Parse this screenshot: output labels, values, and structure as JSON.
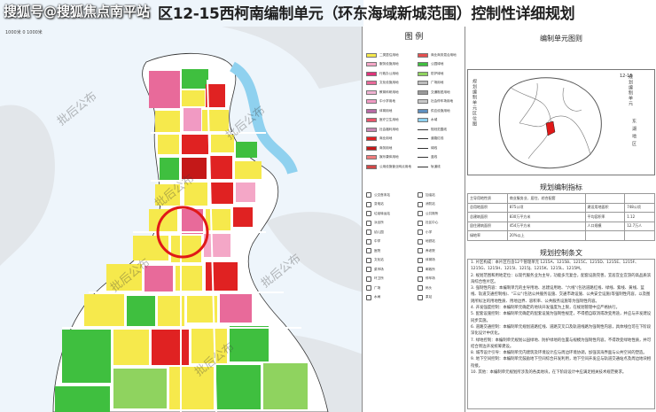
{
  "header": {
    "source_banner": "搜狐号@搜狐焦点南平站",
    "plan_title": "区12-15西柯南编制单元（环东海域新城范围）控制性详细规划"
  },
  "map": {
    "scale_note": "1000米  0  1000米",
    "watermark": "批后公布"
  },
  "legend": {
    "title": "图  例",
    "items": [
      {
        "label": "二类居住用地",
        "color": "#f6e94c"
      },
      {
        "label": "服务设施用地",
        "color": "#f4a7c7"
      },
      {
        "label": "行政办公用地",
        "color": "#e0337a"
      },
      {
        "label": "文化设施用地",
        "color": "#e86a9a"
      },
      {
        "label": "教育科研用地",
        "color": "#f0b2d2"
      },
      {
        "label": "中小学用地",
        "color": "#f19ac3"
      },
      {
        "label": "体育用地",
        "color": "#b86ba6"
      },
      {
        "label": "医疗卫生用地",
        "color": "#e9556d"
      },
      {
        "label": "社会福利用地",
        "color": "#c78ab4"
      },
      {
        "label": "商业用地",
        "color": "#e02222"
      },
      {
        "label": "商务用地",
        "color": "#c41818"
      },
      {
        "label": "娱乐康体用地",
        "color": "#f07d7d"
      },
      {
        "label": "公用设施营业网点用地",
        "color": "#d04848"
      },
      {
        "label": "商业商务混合用地",
        "color": "#e55050"
      },
      {
        "label": "公园绿地",
        "color": "#3fbf3f"
      },
      {
        "label": "防护绿地",
        "color": "#8fd35f"
      },
      {
        "label": "广场用地",
        "color": "#bcbcbc"
      },
      {
        "label": "交通枢纽用地",
        "color": "#9a9a9a"
      },
      {
        "label": "社会停车场用地",
        "color": "#c8c8c8"
      },
      {
        "label": "供应设施用地",
        "color": "#5f8fbf"
      },
      {
        "label": "水域",
        "color": "#8fd1ef"
      },
      {
        "label": "规划范围线",
        "line": true
      },
      {
        "label": "道路红线",
        "line": true
      },
      {
        "label": "绿线",
        "line": true
      },
      {
        "label": "蓝线",
        "line": true
      },
      {
        "label": "轨道线",
        "line": true
      }
    ],
    "symbols": [
      "公交首末站",
      "加油站",
      "变电站",
      "消防站",
      "垃圾转运站",
      "公共厕所",
      "派出所",
      "社区中心",
      "幼儿园",
      "小学",
      "中学",
      "地铁站",
      "医院",
      "养老院",
      "文化站",
      "体育场",
      "菜市场",
      "邮政所",
      "环卫所",
      "停车场",
      "广场",
      "码头",
      "水闸",
      "泵站"
    ]
  },
  "panel": {
    "unit_title": "编制单元图则",
    "locator_vertical_left": "规划编制单元区位图",
    "locator_vertical_right": "东 湖 地 区",
    "locator_right_top": "规划编制单元",
    "locator_unit_label": "12-15",
    "indicator_title": "规划编制指标",
    "indicator_rows": [
      [
        "主导用地性质",
        "商业服务业、居住、综合配套",
        "",
        ""
      ],
      [
        "总用地面积",
        "875公顷",
        "建设用地面积",
        "748公顷"
      ],
      [
        "总建筑面积",
        "830万平方米",
        "平均容积率",
        "1.12"
      ],
      [
        "居住建筑面积",
        "454万平方米",
        "人口规模",
        "12.7万人"
      ],
      [
        "绿地率",
        "20%以上",
        "",
        ""
      ]
    ],
    "text_title": "规划控制条文",
    "text_paragraphs": [
      "1. 片区构成：本片区包含12个管理单元 1215A、1215B、1215C、1215D、1215E、1215F、1215G、1215H、1215I、1215J、1215K、1215L、1215M。",
      "2. 规划范围和用地定位：以现代服务业为主导，功能多元复合，配套设施完善，宜居宜业宜游的高品质滨海综合性片区。",
      "3. 强制性内容：本编制单元的主导用地、总建设用地、\"六线\"(包括道路红线、绿线、紫线、黄线、蓝线、轨道交通控制线)、\"三公\"(包括公共服务设施、交通市政设施、公共安全设施)等强制性内容，以及图则所标注的用地性质、用地边界、容积率、公共服务设施等为强制性内容。",
      "4. 开发强度控制：本编制单元确定的地块开发强度为上限，在规划管理中应严格执行。",
      "5. 配套设施控制：本编制单元确定的配套设施为强制性规定，不得擅自取消或改变用途，并应与开发建设同步实施。",
      "6. 道路交通控制：本编制单元规划道路红线、道路交叉口及轨道线路为强制性内容，具体线位可在下阶段深化设计中优化。",
      "7. 绿地控制：本编制单元规划公园绿地、防护绿地的位置与规模为强制性内容，不得改变绿地性质，并可结合周边开发统筹建设。",
      "8. 城市设计引导：本编制单元内建筑及环境设计应与周边环境协调，加强滨海界面与公共空间的塑造。",
      "9. 地下空间控制：本编制单元鼓励地下空间综合开发利用，地下空间开发应与轨道交通站点及周边地块相衔接。",
      "10. 其他：本编制单元规划所涉及的各类地块，在下阶段设计中应满足相关技术规范要求。"
    ]
  }
}
